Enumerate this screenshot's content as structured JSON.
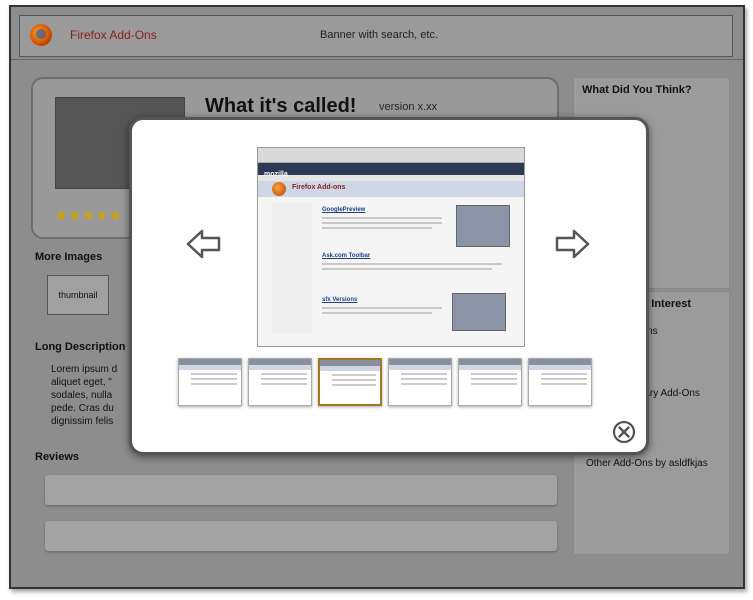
{
  "banner": {
    "logo_text": "Firefox Add-Ons",
    "text": "Banner with search, etc."
  },
  "addon": {
    "name": "What it's called!",
    "version": "version x.xx",
    "rating_stars": "★★★★★"
  },
  "sections": {
    "more_images": "More Images",
    "thumbnail_label": "thumbnail",
    "long_description": "Long Description",
    "description_lines": [
      "Lorem ipsum d",
      "aliquet eget, \"",
      "sodales, nulla",
      "pede. Cras du",
      "dignissim felis"
    ],
    "reviews": "Reviews"
  },
  "sidebar": {
    "feedback_title": "What Did You Think?",
    "interest_title_fragment": "Of Interest",
    "interest_items": [
      "-Ons",
      "ntary Add-Ons"
    ],
    "other_by_author": "Other Add-Ons by asldfkjas"
  },
  "modal": {
    "screenshot": {
      "brand": "mozilla",
      "header": "Firefox Add-ons",
      "links": [
        "GooglePreview",
        "Ask.com Toolbar",
        "sfx Versions"
      ]
    },
    "selected_thumbnail_index": 2,
    "thumbnail_count": 6,
    "icons": {
      "prev": "left-arrow-icon",
      "next": "right-arrow-icon",
      "close": "close-icon"
    }
  }
}
